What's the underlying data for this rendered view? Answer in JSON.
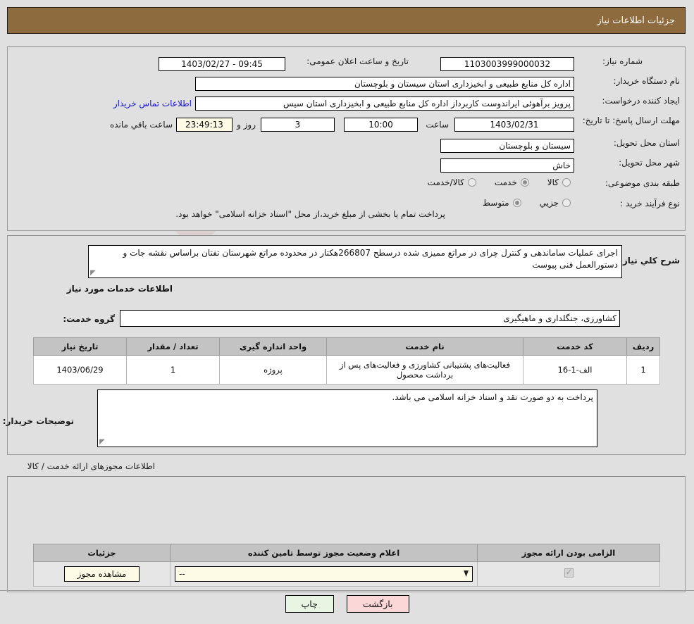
{
  "header": {
    "title": "جزئیات اطلاعات نیاز"
  },
  "top_form": {
    "need_number_label": "شماره نیاز:",
    "need_number_value": "1103003999000032",
    "announce_label": "تاریخ و ساعت اعلان عمومی:",
    "announce_value": "09:45 - 1403/02/27",
    "buyer_org_label": "نام دستگاه خریدار:",
    "buyer_org_value": "اداره کل منابع طبیعی و ابخیزداری استان سیستان و بلوچستان",
    "creator_label": "ایجاد کننده درخواست:",
    "creator_value": "پرویز برآهوئی ایراندوست کاربرداز اداره کل منابع طبیعی و ابخیزداری استان سیس",
    "contact_link": "اطلاعات تماس خریدار",
    "deadline_label": "مهلت ارسال پاسخ: تا تاریخ:",
    "deadline_date": "1403/02/31",
    "hour_label": "ساعت",
    "deadline_hour": "10:00",
    "days_value": "3",
    "days_label": "روز و",
    "countdown_value": "23:49:13",
    "countdown_label": "ساعت باقي مانده",
    "province_label": "استان محل تحویل:",
    "province_value": "سیستان و بلوچستان",
    "city_label": "شهر محل تحویل:",
    "city_value": "خاش",
    "category_label": "طبقه بندی موضوعی:",
    "category_options": [
      {
        "label": "کالا",
        "selected": false
      },
      {
        "label": "خدمت",
        "selected": true
      },
      {
        "label": "کالا/خدمت",
        "selected": false
      }
    ],
    "process_label": "نوع فرآیند خرید :",
    "process_options": [
      {
        "label": "جزیي",
        "selected": false
      },
      {
        "label": "متوسط",
        "selected": true
      }
    ],
    "payment_note": "پرداخت تمام یا بخشی از مبلغ خرید،از محل \"اسناد خزانه اسلامی\" خواهد بود."
  },
  "middle": {
    "summary_label": "شرح کلي نیاز:",
    "summary_value": "اجرای عملیات ساماندهی و کنترل چرای در مراتع ممیزی شده درسطح 266807هکتار در محدوده مراتع شهرستان تفتان براساس نقشه جات و دستورالعمل فنی پیوست",
    "services_section_title": "اطلاعات خدمات مورد نیاز",
    "service_group_label": "گروه خدمت:",
    "service_group_value": "کشاورزی، جنگلداری و ماهیگیری",
    "table": {
      "columns": [
        "ردیف",
        "کد خدمت",
        "نام خدمت",
        "واحد اندازه گیری",
        "تعداد / مقدار",
        "تاریخ نیاز"
      ],
      "rows": [
        {
          "row_no": "1",
          "service_code": "الف-1-16",
          "service_name": "فعالیت‌های پشتیبانی کشاورزی و فعالیت‌های پس از برداشت محصول",
          "unit": "پروژه",
          "quantity": "1",
          "need_date": "1403/06/29"
        }
      ]
    },
    "buyer_notes_label": "توضیحات خریدار:",
    "buyer_notes_value": "پرداخت به دو صورت نقد و اسناد خزانه اسلامی می باشد."
  },
  "permits": {
    "section_title": "اطلاعات مجوزهای ارائه خدمت / کالا",
    "columns": [
      "الزامی بودن ارائه مجوز",
      "اعلام وضعیت مجوز توسط تامین کننده",
      "جزئیات"
    ],
    "rows": [
      {
        "required_checked": true,
        "status_value": "--",
        "details_button": "مشاهده مجوز"
      }
    ]
  },
  "footer": {
    "print_label": "چاپ",
    "back_label": "بازگشت"
  },
  "colors": {
    "header_brown": "#8d6b3f",
    "page_bg": "#e0e0e0",
    "link_blue": "#1414d0",
    "table_header_gray": "#c3c3c3",
    "cream_field": "#fdfbe6",
    "print_green": "#e7f5e2",
    "back_pink": "#fbd7d7"
  }
}
